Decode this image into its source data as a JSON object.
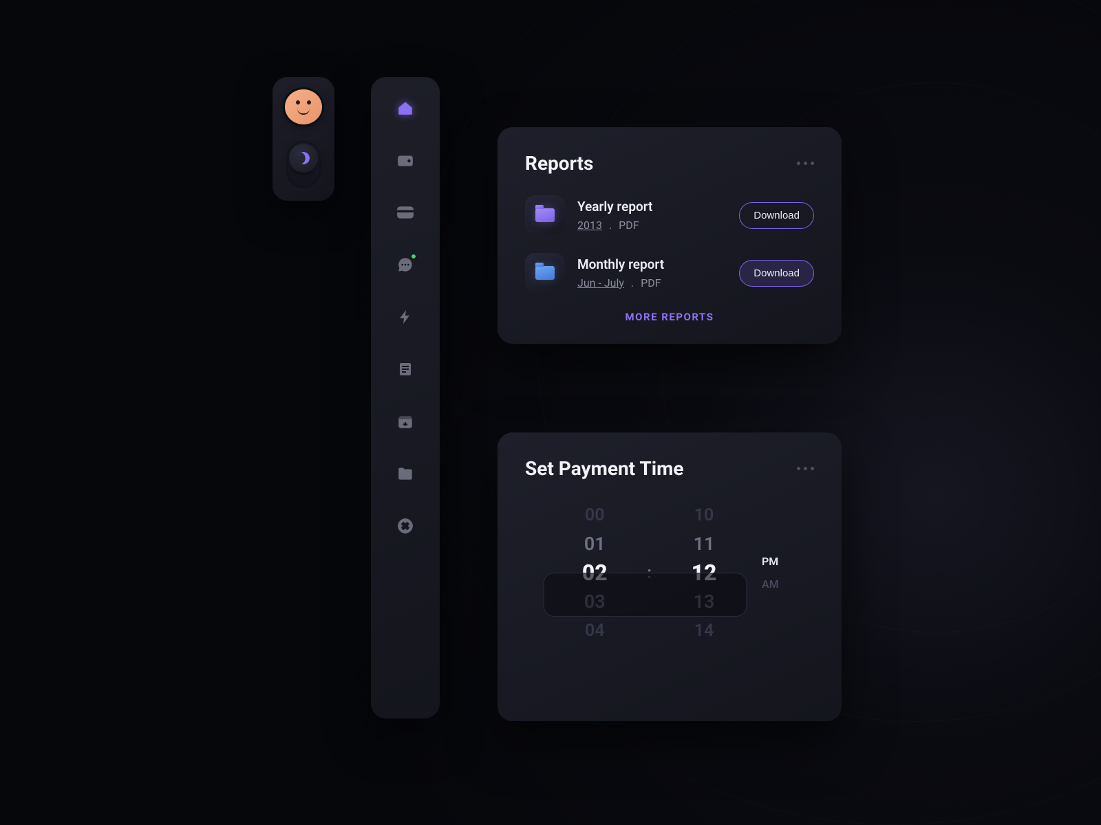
{
  "sidebar": {
    "items": [
      {
        "name": "home"
      },
      {
        "name": "wallet"
      },
      {
        "name": "card"
      },
      {
        "name": "chat",
        "badge": true
      },
      {
        "name": "bolt"
      },
      {
        "name": "list"
      },
      {
        "name": "calendar"
      },
      {
        "name": "folder"
      },
      {
        "name": "help"
      }
    ]
  },
  "reports": {
    "title": "Reports",
    "items": [
      {
        "title": "Yearly report",
        "meta_link": "2013",
        "meta_type": "PDF",
        "action": "Download",
        "folder_color": "purple"
      },
      {
        "title": "Monthly report",
        "meta_link": "Jun - July",
        "meta_type": "PDF",
        "action": "Download",
        "folder_color": "blue"
      }
    ],
    "more_label": "MORE REPORTS"
  },
  "payment_time": {
    "title": "Set Payment Time",
    "hours": [
      "00",
      "01",
      "02",
      "03",
      "04"
    ],
    "minutes": [
      "10",
      "11",
      "12",
      "13",
      "14"
    ],
    "ampm": [
      "PM",
      "AM"
    ],
    "selected_ampm": "PM",
    "colon": ":"
  }
}
